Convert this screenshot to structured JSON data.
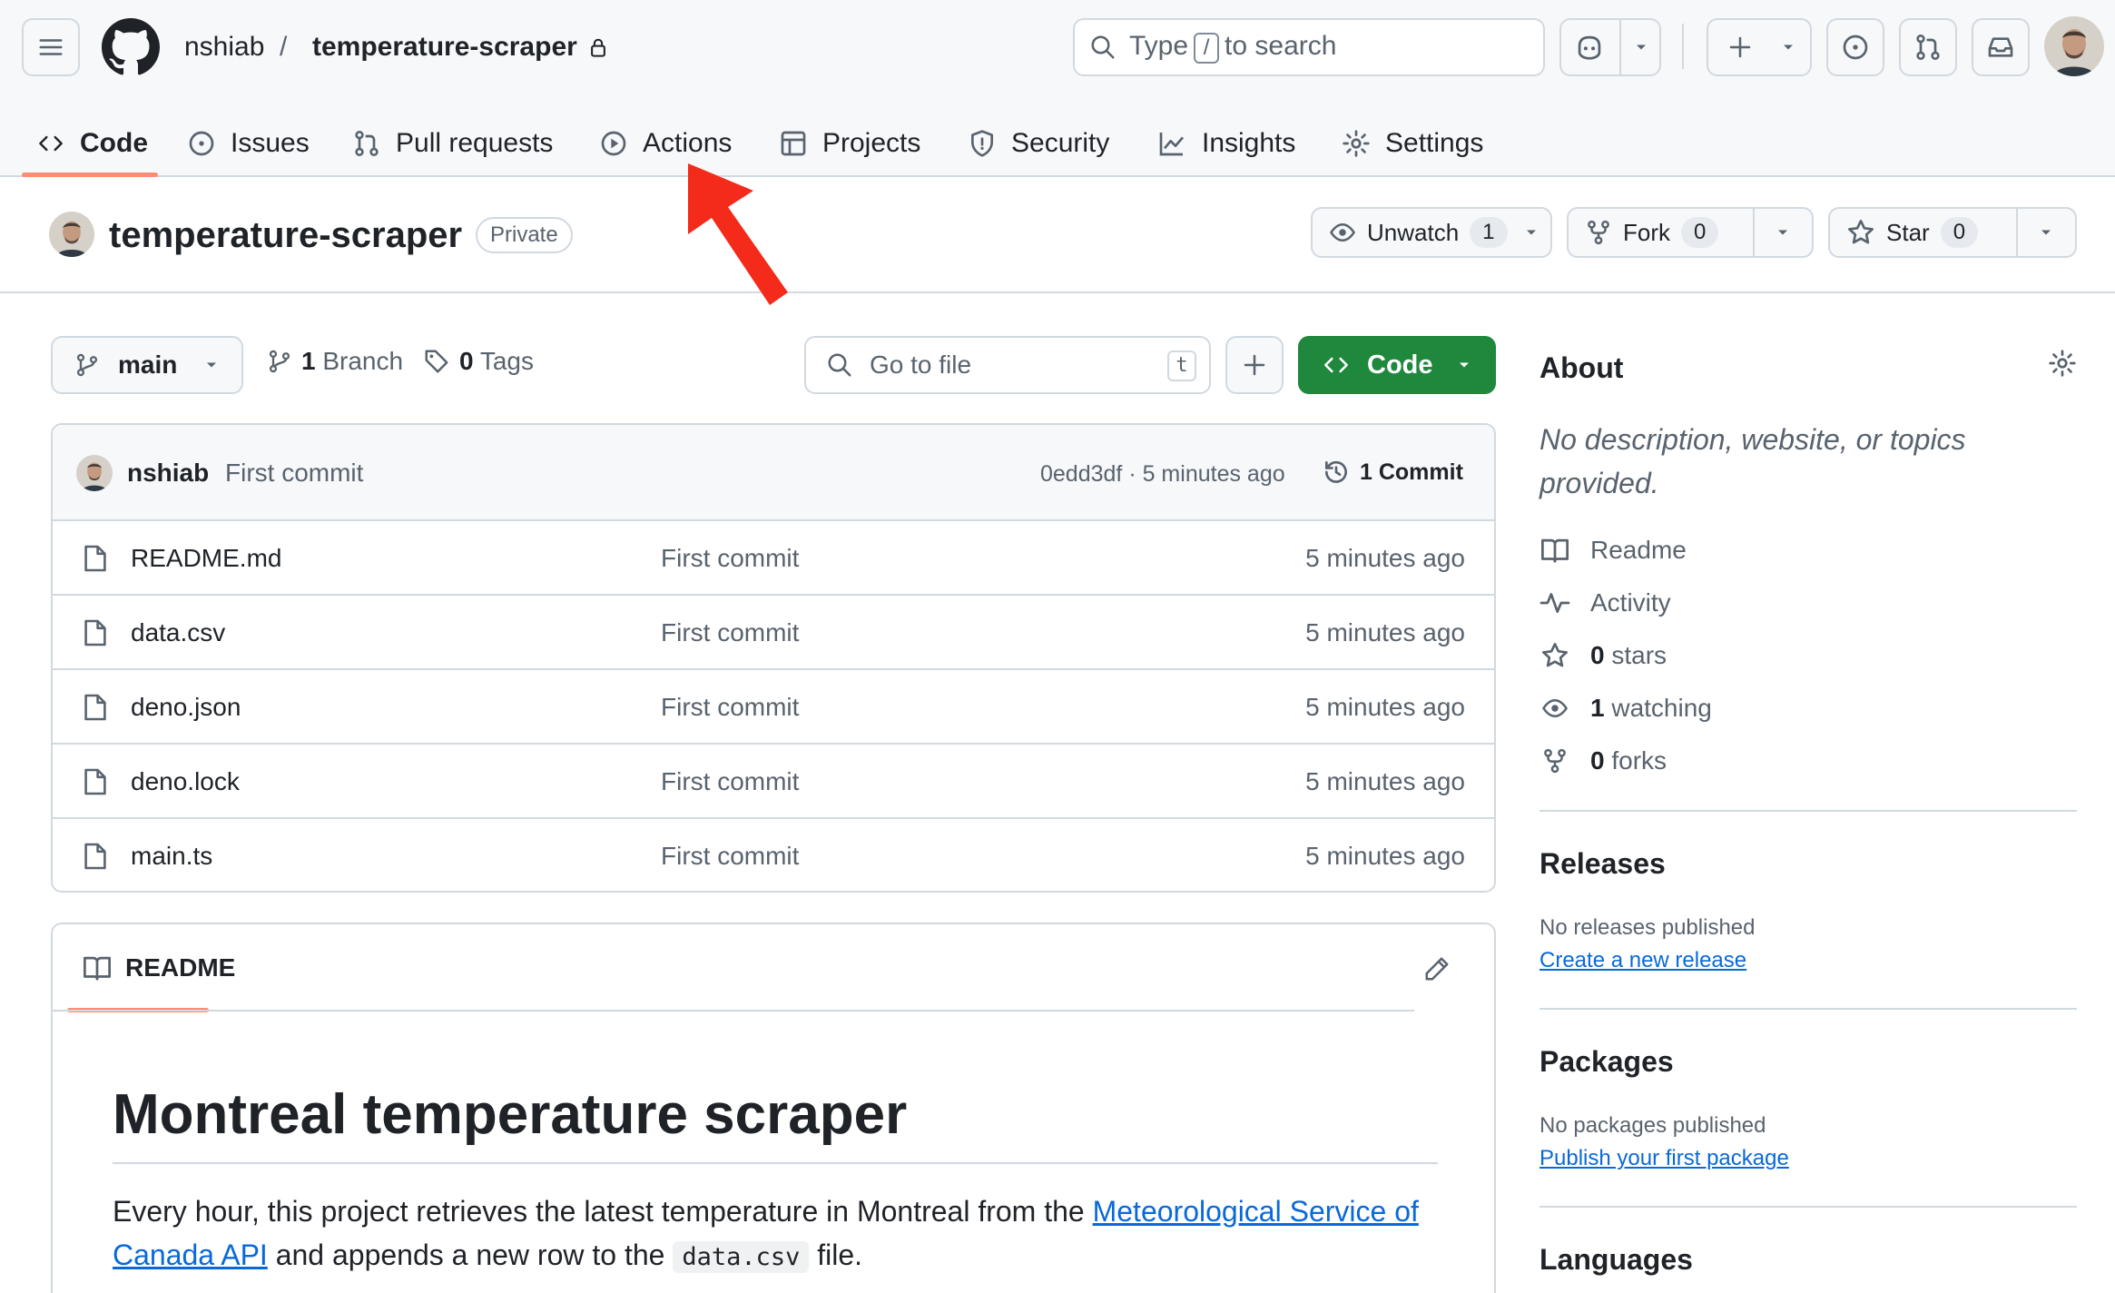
{
  "header": {
    "owner": "nshiab",
    "separator": "/",
    "repo": "temperature-scraper",
    "search": {
      "prefix": "Type",
      "key": "/",
      "suffix": "to search"
    }
  },
  "tabs": [
    {
      "label": "Code",
      "icon": "code-icon",
      "active": true
    },
    {
      "label": "Issues",
      "icon": "issue-icon"
    },
    {
      "label": "Pull requests",
      "icon": "pull-request-icon"
    },
    {
      "label": "Actions",
      "icon": "play-icon"
    },
    {
      "label": "Projects",
      "icon": "table-icon"
    },
    {
      "label": "Security",
      "icon": "shield-icon"
    },
    {
      "label": "Insights",
      "icon": "graph-icon"
    },
    {
      "label": "Settings",
      "icon": "gear-icon"
    }
  ],
  "repo": {
    "name": "temperature-scraper",
    "visibility": "Private",
    "watch": {
      "label": "Unwatch",
      "count": "1"
    },
    "fork": {
      "label": "Fork",
      "count": "0"
    },
    "star": {
      "label": "Star",
      "count": "0"
    }
  },
  "toolbar": {
    "branch": "main",
    "branches_count": "1",
    "branches_label": "Branch",
    "tags_count": "0",
    "tags_label": "Tags",
    "goto_placeholder": "Go to file",
    "goto_key": "t",
    "code_label": "Code"
  },
  "commit": {
    "author": "nshiab",
    "message": "First commit",
    "meta": "0edd3df · 5 minutes ago",
    "count_label": "1 Commit"
  },
  "files": [
    {
      "name": "README.md",
      "message": "First commit",
      "time": "5 minutes ago"
    },
    {
      "name": "data.csv",
      "message": "First commit",
      "time": "5 minutes ago"
    },
    {
      "name": "deno.json",
      "message": "First commit",
      "time": "5 minutes ago"
    },
    {
      "name": "deno.lock",
      "message": "First commit",
      "time": "5 minutes ago"
    },
    {
      "name": "main.ts",
      "message": "First commit",
      "time": "5 minutes ago"
    }
  ],
  "readme": {
    "tab_label": "README",
    "title": "Montreal temperature scraper",
    "p_before": "Every hour, this project retrieves the latest temperature in Montreal from the ",
    "p_link": "Meteorological Service of Canada API",
    "p_middle": " and appends a new row to the ",
    "p_code": "data.csv",
    "p_after": " file."
  },
  "sidebar": {
    "about_title": "About",
    "description": "No description, website, or topics provided.",
    "items": [
      {
        "icon": "book-icon",
        "bold": "",
        "text": "Readme"
      },
      {
        "icon": "pulse-icon",
        "bold": "",
        "text": "Activity"
      },
      {
        "icon": "star-icon",
        "bold": "0",
        "text": " stars"
      },
      {
        "icon": "eye-icon",
        "bold": "1",
        "text": " watching"
      },
      {
        "icon": "fork-icon",
        "bold": "0",
        "text": " forks"
      }
    ],
    "releases_title": "Releases",
    "releases_none": "No releases published",
    "releases_link": "Create a new release",
    "packages_title": "Packages",
    "packages_none": "No packages published",
    "packages_link": "Publish your first package",
    "languages_title": "Languages"
  },
  "colors": {
    "accent_green": "#1f883d",
    "link_blue": "#0969da",
    "tab_underline": "#fd8c73",
    "annotation_arrow": "#f42a1b"
  }
}
